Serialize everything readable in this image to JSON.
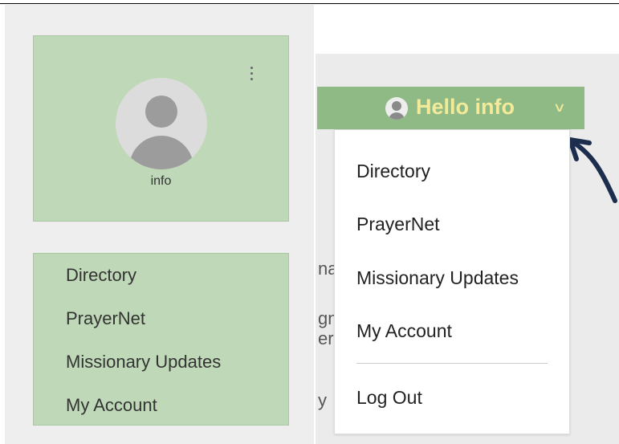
{
  "profile": {
    "name": "info",
    "avatar_icon": "user-avatar-icon",
    "more_icon": "kebab-menu-icon"
  },
  "left_menu": {
    "items": [
      {
        "label": "Directory"
      },
      {
        "label": "PrayerNet"
      },
      {
        "label": "Missionary Updates"
      },
      {
        "label": "My Account"
      }
    ]
  },
  "background_fragments": [
    "na",
    "gn",
    "er",
    "y"
  ],
  "header": {
    "greeting": "Hello info",
    "dropdown_icon": "chevron-down-icon"
  },
  "dropdown": {
    "items": [
      {
        "label": "Directory"
      },
      {
        "label": "PrayerNet"
      },
      {
        "label": "Missionary Updates"
      },
      {
        "label": "My Account"
      }
    ],
    "logout_label": "Log Out"
  },
  "colors": {
    "panel_green": "#bfd9b8",
    "header_green": "#8fba85",
    "header_text": "#f3ea9a",
    "arrow": "#1c2d4e"
  }
}
